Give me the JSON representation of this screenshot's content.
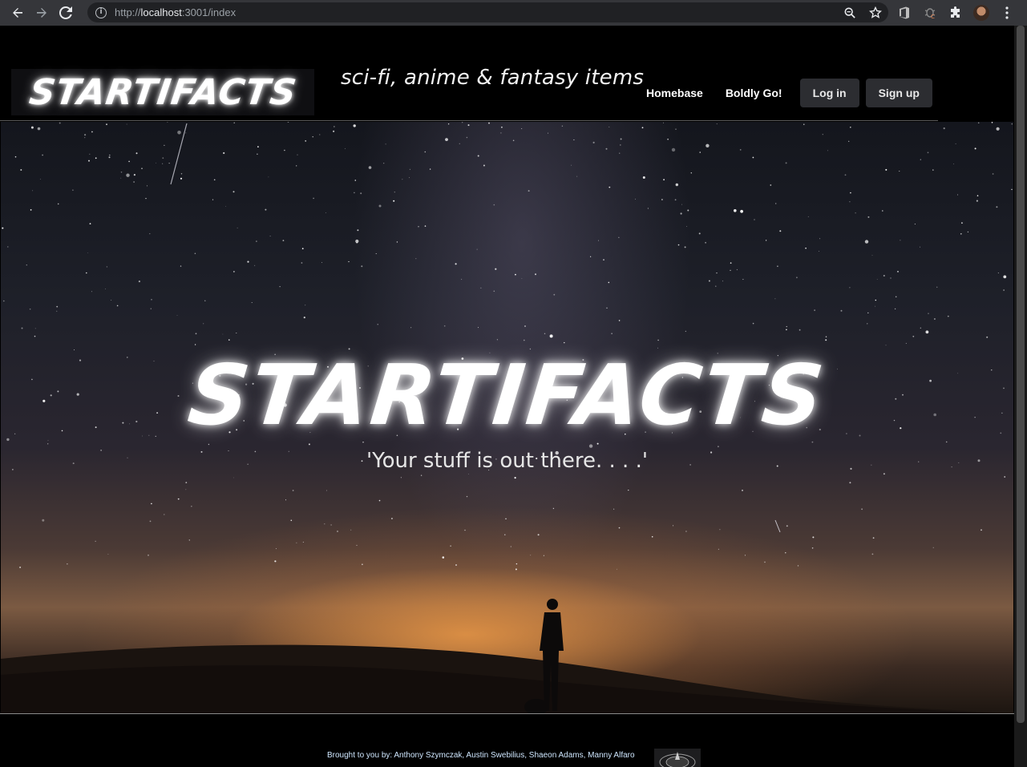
{
  "browser": {
    "url_scheme": "http://",
    "url_host": "localhost",
    "url_rest": ":3001/index",
    "icons": [
      "back-icon",
      "forward-icon",
      "reload-icon",
      "info-icon",
      "zoom-icon",
      "bookmark-star-icon",
      "extension-office-icon",
      "extension-bug-icon",
      "extensions-puzzle-icon",
      "profile-avatar",
      "menu-kebab-icon"
    ]
  },
  "header": {
    "logo": "STARTIFACTS",
    "tagline": "sci-fi, anime & fantasy items",
    "nav": {
      "homebase": "Homebase",
      "boldly_go": "Boldly Go!",
      "login": "Log in",
      "signup": "Sign up"
    }
  },
  "hero": {
    "title": "STARTIFACTS",
    "subtitle": "'Your stuff is out there. . . .'"
  },
  "footer": {
    "credits": "Brought to you by: Anthony Szymczak, Austin Swebilius, Shaeon Adams, Manny Alfaro"
  },
  "colors": {
    "background": "#000000",
    "chrome": "#35363a",
    "omnibox": "#202124",
    "button_bg": "#2c2d31",
    "credits_text": "#cfe7ff",
    "horizon_glow": "#e6964a"
  }
}
